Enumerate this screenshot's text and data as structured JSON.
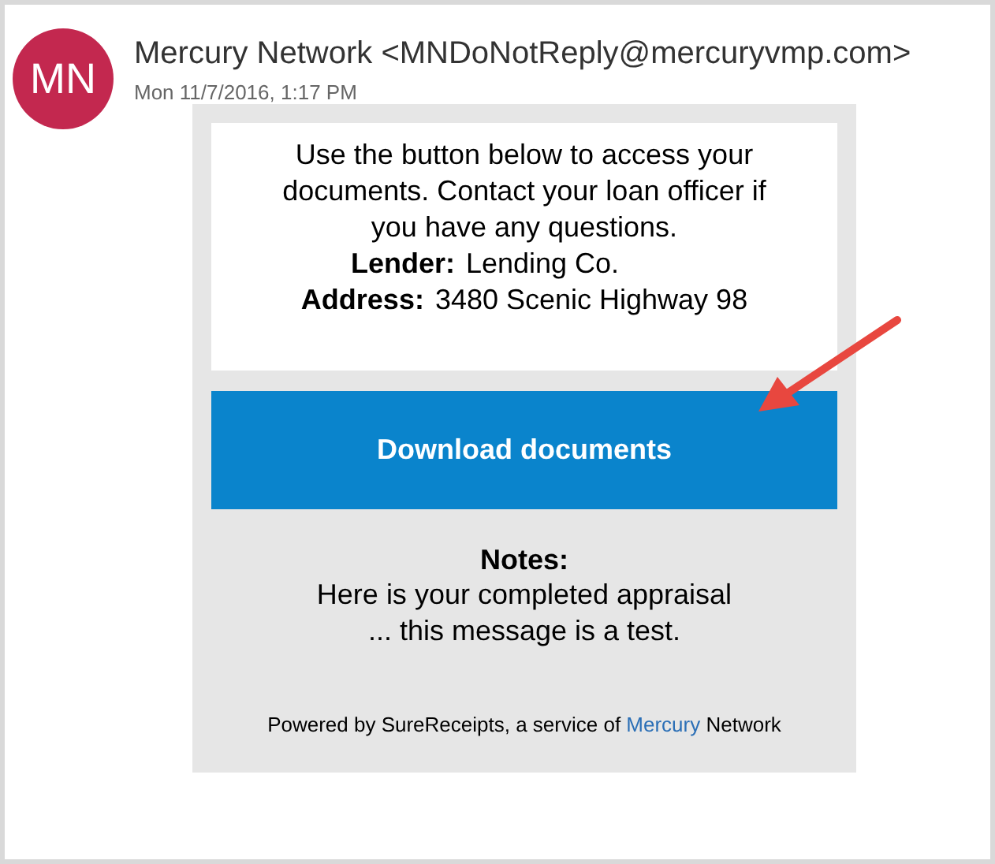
{
  "header": {
    "avatar_initials": "MN",
    "sender": "Mercury Network <MNDoNotReply@mercuryvmp.com>",
    "date": "Mon 11/7/2016, 1:17 PM"
  },
  "message": {
    "intro": "Use the button below to access your documents. Contact your loan officer if you have any questions.",
    "fields": [
      {
        "label": "Lender:",
        "value": "Lending Co."
      },
      {
        "label": "Address:",
        "value": "3480 Scenic Highway 98"
      }
    ],
    "button": "Download documents",
    "notes_title": "Notes:",
    "notes_text": "Here is your completed appraisal ... this message is a test.",
    "footer": {
      "before": "Powered by SureReceipts, a service of ",
      "link": "Mercury",
      "after": " Network"
    }
  }
}
